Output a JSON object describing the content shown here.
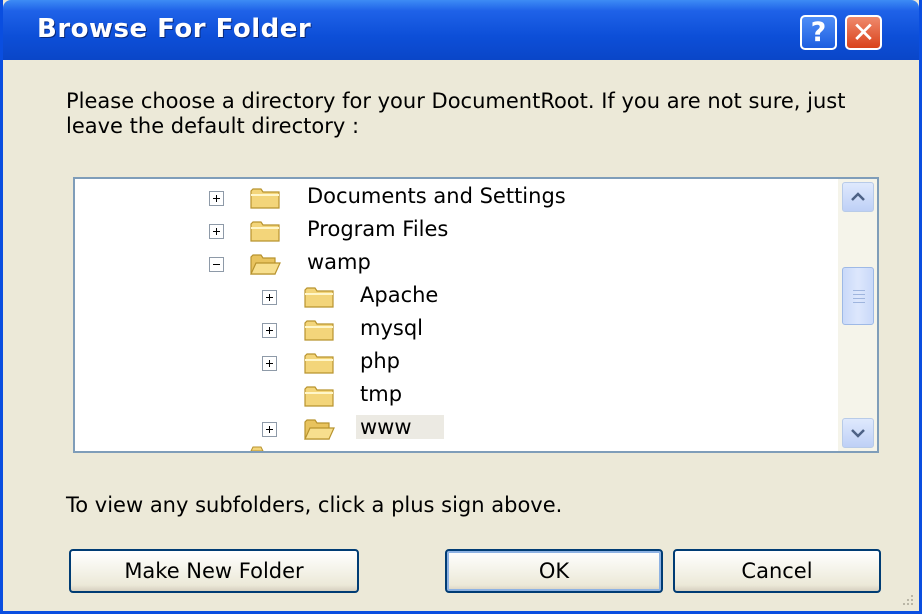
{
  "window": {
    "title": "Browse For Folder",
    "help_glyph": "?",
    "close_glyph": "✕"
  },
  "prompt": "Please choose a directory for your DocumentRoot. If you are not sure, just leave the default directory :",
  "tree": {
    "items": [
      {
        "label": "Documents and Settings",
        "expander": "plus"
      },
      {
        "label": "Program Files",
        "expander": "plus"
      },
      {
        "label": "wamp",
        "expander": "minus",
        "open": true
      },
      {
        "label": "Apache",
        "expander": "plus"
      },
      {
        "label": "mysql",
        "expander": "plus"
      },
      {
        "label": "php",
        "expander": "plus"
      },
      {
        "label": "tmp",
        "expander": "none"
      },
      {
        "label": "www",
        "expander": "plus",
        "selected": true,
        "open": true
      }
    ]
  },
  "hint": "To view any subfolders, click a plus sign above.",
  "buttons": {
    "make_new_folder": "Make New Folder",
    "ok": "OK",
    "cancel": "Cancel"
  },
  "colors": {
    "title_bar": "#0a4ee0",
    "folder": "#f3d57a",
    "dialog_face": "#ece9d8"
  }
}
